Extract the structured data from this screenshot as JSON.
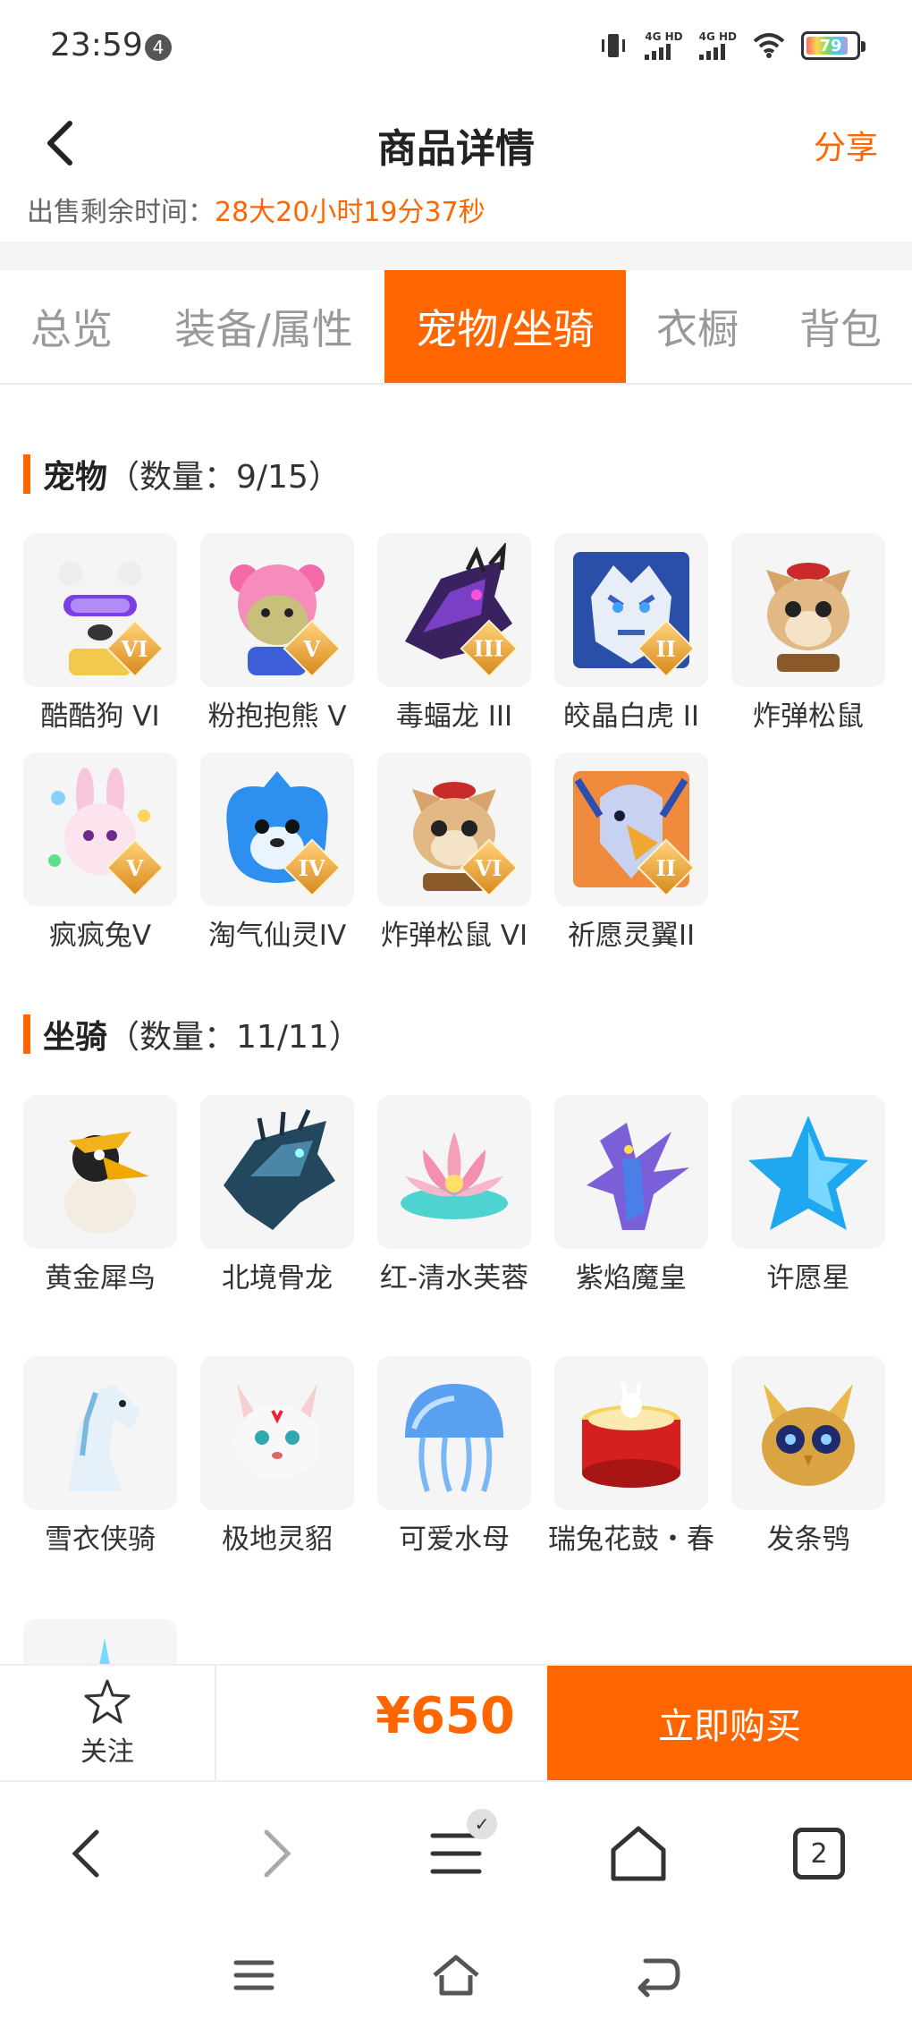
{
  "status_bar": {
    "time": "23:59",
    "notification_count": "4",
    "sim1": "4G HD",
    "sim2": "4G HD",
    "battery": "79"
  },
  "header": {
    "title": "商品详情",
    "share": "分享"
  },
  "countdown": {
    "label": "出售剩余时间：",
    "value": "28大20小时19分37秒"
  },
  "tabs": [
    {
      "label": "总览"
    },
    {
      "label": "装备/属性"
    },
    {
      "label": "宠物/坐骑"
    },
    {
      "label": "衣橱"
    },
    {
      "label": "背包"
    }
  ],
  "active_tab": "宠物/坐骑",
  "pets": {
    "title": "宠物",
    "count": "（数量：9/15）",
    "items": [
      {
        "name": "酷酷狗 VI",
        "rank": "VI",
        "icon": "white-bear-goggles-icon"
      },
      {
        "name": "粉抱抱熊 V",
        "rank": "V",
        "icon": "pink-bear-icon"
      },
      {
        "name": "毒蝠龙 III",
        "rank": "III",
        "icon": "purple-dragon-icon"
      },
      {
        "name": "皎晶白虎 II",
        "rank": "II",
        "icon": "white-tiger-icon"
      },
      {
        "name": "炸弹松鼠",
        "rank": "",
        "icon": "squirrel-icon"
      },
      {
        "name": "疯疯兔V",
        "rank": "V",
        "icon": "pink-rabbit-icon"
      },
      {
        "name": "淘气仙灵IV",
        "rank": "IV",
        "icon": "blue-spirit-icon"
      },
      {
        "name": "炸弹松鼠 VI",
        "rank": "VI",
        "icon": "squirrel-icon"
      },
      {
        "name": "祈愿灵翼II",
        "rank": "II",
        "icon": "eagle-icon"
      }
    ]
  },
  "mounts": {
    "title": "坐骑",
    "count": "（数量：11/11）",
    "items": [
      {
        "name": "黄金犀鸟",
        "icon": "hornbill-icon"
      },
      {
        "name": "北境骨龙",
        "icon": "bone-dragon-icon"
      },
      {
        "name": "红-清水芙蓉",
        "icon": "lotus-icon"
      },
      {
        "name": "紫焰魔皇",
        "icon": "purple-phoenix-icon"
      },
      {
        "name": "许愿星",
        "icon": "blue-star-icon"
      },
      {
        "name": "雪衣侠骑",
        "icon": "white-horse-icon"
      },
      {
        "name": "极地灵貂",
        "icon": "white-fox-icon"
      },
      {
        "name": "可爱水母",
        "icon": "jellyfish-icon"
      },
      {
        "name": "瑞兔花鼓・春",
        "icon": "red-drum-icon"
      },
      {
        "name": "发条鸮",
        "icon": "owl-icon"
      },
      {
        "name": "",
        "icon": "partial-mount-icon"
      }
    ]
  },
  "action_bar": {
    "follow": "关注",
    "price": "¥650",
    "buy": "立即购买"
  },
  "browser_nav": {
    "tab_count": "2"
  },
  "colors": {
    "accent": "#ff6600",
    "card_bg": "#f5f5f5"
  }
}
